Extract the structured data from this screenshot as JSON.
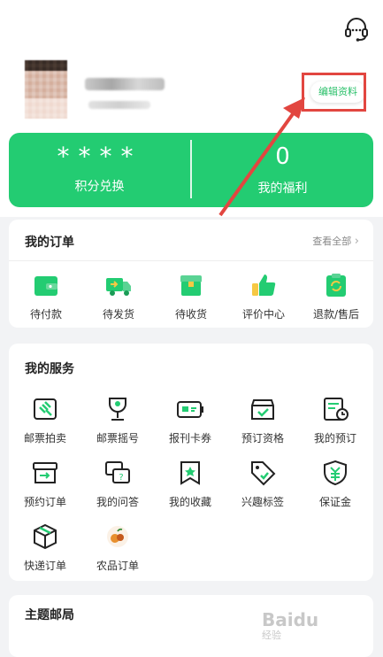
{
  "header": {
    "edit_label": "编辑资料"
  },
  "banner": {
    "points_value": "****",
    "points_label": "积分兑换",
    "welfare_value": "0",
    "welfare_label": "我的福利"
  },
  "orders": {
    "title": "我的订单",
    "view_all": "查看全部",
    "items": [
      {
        "label": "待付款",
        "icon": "wallet-icon"
      },
      {
        "label": "待发货",
        "icon": "truck-icon"
      },
      {
        "label": "待收货",
        "icon": "box-icon"
      },
      {
        "label": "评价中心",
        "icon": "thumbs-up-icon"
      },
      {
        "label": "退款/售后",
        "icon": "refund-icon"
      }
    ]
  },
  "services": {
    "title": "我的服务",
    "items": [
      {
        "label": "邮票拍卖",
        "icon": "auction-icon"
      },
      {
        "label": "邮票摇号",
        "icon": "lottery-icon"
      },
      {
        "label": "报刊卡券",
        "icon": "card-icon"
      },
      {
        "label": "预订资格",
        "icon": "qualification-icon"
      },
      {
        "label": "我的预订",
        "icon": "reservation-icon"
      },
      {
        "label": "预约订单",
        "icon": "appointment-icon"
      },
      {
        "label": "我的问答",
        "icon": "qa-icon"
      },
      {
        "label": "我的收藏",
        "icon": "favorite-icon"
      },
      {
        "label": "兴趣标签",
        "icon": "tag-icon"
      },
      {
        "label": "保证金",
        "icon": "deposit-icon"
      },
      {
        "label": "快递订单",
        "icon": "package-icon"
      },
      {
        "label": "农品订单",
        "icon": "produce-icon"
      }
    ]
  },
  "theme": {
    "title": "主题邮局"
  },
  "watermark": {
    "text": "Baidu",
    "sub": "经验"
  },
  "colors": {
    "accent": "#23cc72",
    "annotation": "#e24640"
  }
}
